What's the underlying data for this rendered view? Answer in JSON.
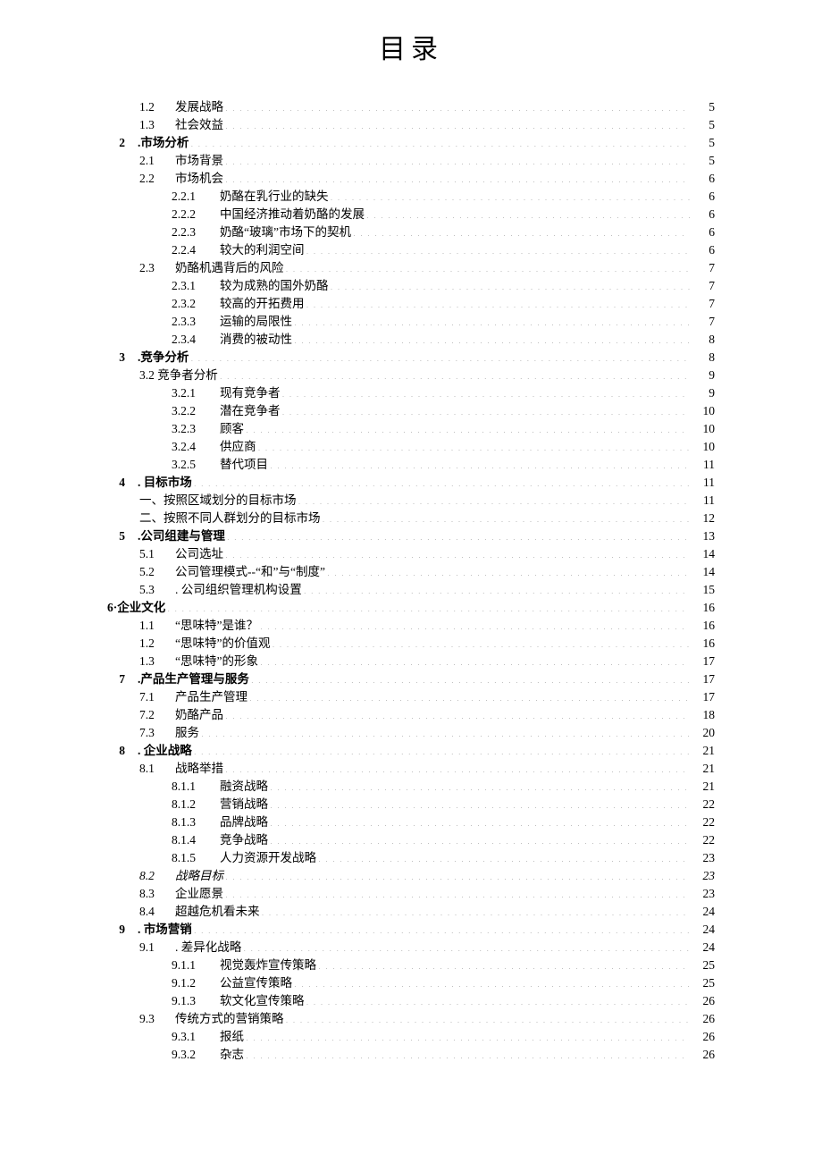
{
  "title": "目录",
  "entries": [
    {
      "level": 1,
      "num": "1.2",
      "text": "发展战略",
      "page": "5"
    },
    {
      "level": 1,
      "num": "1.3",
      "text": "社会效益",
      "page": "5"
    },
    {
      "level": 0,
      "num": "2",
      "text": ".市场分析",
      "page": "5",
      "bold": true
    },
    {
      "level": 1,
      "num": "2.1",
      "text": "市场背景",
      "page": "5"
    },
    {
      "level": 1,
      "num": "2.2",
      "text": "市场机会",
      "page": "6"
    },
    {
      "level": 2,
      "num": "2.2.1",
      "text": "奶酪在乳行业的缺失",
      "page": "6"
    },
    {
      "level": 2,
      "num": "2.2.2",
      "text": "中国经济推动着奶酪的发展",
      "page": "6"
    },
    {
      "level": 2,
      "num": "2.2.3",
      "text": "奶酪“玻璃”市场下的契机",
      "page": "6"
    },
    {
      "level": 2,
      "num": "2.2.4",
      "text": "较大的利润空间",
      "page": "6"
    },
    {
      "level": 1,
      "num": "2.3",
      "text": "奶酪机遇背后的风险",
      "page": "7"
    },
    {
      "level": 2,
      "num": "2.3.1",
      "text": "较为成熟的国外奶酪",
      "page": "7"
    },
    {
      "level": 2,
      "num": "2.3.2",
      "text": "较高的开拓费用",
      "page": "7"
    },
    {
      "level": 2,
      "num": "2.3.3",
      "text": "运输的局限性",
      "page": "7"
    },
    {
      "level": 2,
      "num": "2.3.4",
      "text": "消费的被动性",
      "page": "8"
    },
    {
      "level": 0,
      "num": "3",
      "text": ".竞争分析",
      "page": "8",
      "bold": true
    },
    {
      "level": 1,
      "num": "",
      "text": "3.2 竞争者分析",
      "page": "9"
    },
    {
      "level": 2,
      "num": "3.2.1",
      "text": "现有竞争者",
      "page": "9"
    },
    {
      "level": 2,
      "num": "3.2.2",
      "text": "潜在竞争者",
      "page": "10"
    },
    {
      "level": 2,
      "num": "3.2.3",
      "text": "顾客",
      "page": "10"
    },
    {
      "level": 2,
      "num": "3.2.4",
      "text": "供应商",
      "page": "10"
    },
    {
      "level": 2,
      "num": "3.2.5",
      "text": "替代项目",
      "page": "11"
    },
    {
      "level": 0,
      "num": "4",
      "text": ". 目标市场",
      "page": "11",
      "bold": true
    },
    {
      "level": 1,
      "num": "",
      "text": "一、按照区域划分的目标市场",
      "page": "11"
    },
    {
      "level": 1,
      "num": "",
      "text": "二、按照不同人群划分的目标市场",
      "page": "12"
    },
    {
      "level": 0,
      "num": "5",
      "text": ".公司组建与管理",
      "page": "13",
      "bold": true
    },
    {
      "level": 1,
      "num": "5.1",
      "text": "公司选址",
      "page": "14"
    },
    {
      "level": 1,
      "num": "5.2",
      "text": "公司管理模式--“和”与“制度”",
      "page": "14"
    },
    {
      "level": 1,
      "num": "5.3",
      "text": ". 公司组织管理机构设置",
      "page": "15"
    },
    {
      "level": 0,
      "num": "",
      "text": "6·企业文化",
      "page": "16",
      "bold": true,
      "raw": true
    },
    {
      "level": 1,
      "num": "1.1",
      "text": "“思味特”是谁？",
      "page": "16"
    },
    {
      "level": 1,
      "num": "1.2",
      "text": "“思味特”的价值观",
      "page": "16"
    },
    {
      "level": 1,
      "num": "1.3",
      "text": "“思味特”的形象",
      "page": "17"
    },
    {
      "level": 0,
      "num": "7",
      "text": ".产品生产管理与服务",
      "page": "17",
      "bold": true
    },
    {
      "level": 1,
      "num": "7.1",
      "text": "产品生产管理",
      "page": "17"
    },
    {
      "level": 1,
      "num": "7.2",
      "text": "奶酪产品",
      "page": "18"
    },
    {
      "level": 1,
      "num": "7.3",
      "text": "服务",
      "page": "20"
    },
    {
      "level": 0,
      "num": "8",
      "text": ". 企业战略",
      "page": "21",
      "bold": true
    },
    {
      "level": 1,
      "num": "8.1",
      "text": "战略举措",
      "page": "21"
    },
    {
      "level": 2,
      "num": "8.1.1",
      "text": "融资战略",
      "page": "21"
    },
    {
      "level": 2,
      "num": "8.1.2",
      "text": "营销战略",
      "page": "22"
    },
    {
      "level": 2,
      "num": "8.1.3",
      "text": "品牌战略",
      "page": "22"
    },
    {
      "level": 2,
      "num": "8.1.4",
      "text": "竞争战略",
      "page": "22"
    },
    {
      "level": 2,
      "num": "8.1.5",
      "text": "人力资源开发战略",
      "page": "23"
    },
    {
      "level": 1,
      "num": "8.2",
      "text": "战略目标",
      "page": "23",
      "italic": true
    },
    {
      "level": 1,
      "num": "8.3",
      "text": "企业愿景",
      "page": "23"
    },
    {
      "level": 1,
      "num": "8.4",
      "text": "超越危机看未来",
      "page": "24"
    },
    {
      "level": 0,
      "num": "9",
      "text": ". 市场营销",
      "page": "24",
      "bold": true
    },
    {
      "level": 1,
      "num": "9.1",
      "text": ". 差异化战略",
      "page": "24"
    },
    {
      "level": 2,
      "num": "9.1.1",
      "text": "视觉轰炸宣传策略",
      "page": "25"
    },
    {
      "level": 2,
      "num": "9.1.2",
      "text": "公益宣传策略",
      "page": "25"
    },
    {
      "level": 2,
      "num": "9.1.3",
      "text": "软文化宣传策略",
      "page": "26"
    },
    {
      "level": 1,
      "num": "9.3",
      "text": "传统方式的营销策略",
      "page": "26"
    },
    {
      "level": 2,
      "num": "9.3.1",
      "text": "报纸",
      "page": "26"
    },
    {
      "level": 2,
      "num": "9.3.2",
      "text": "杂志",
      "page": "26"
    }
  ]
}
